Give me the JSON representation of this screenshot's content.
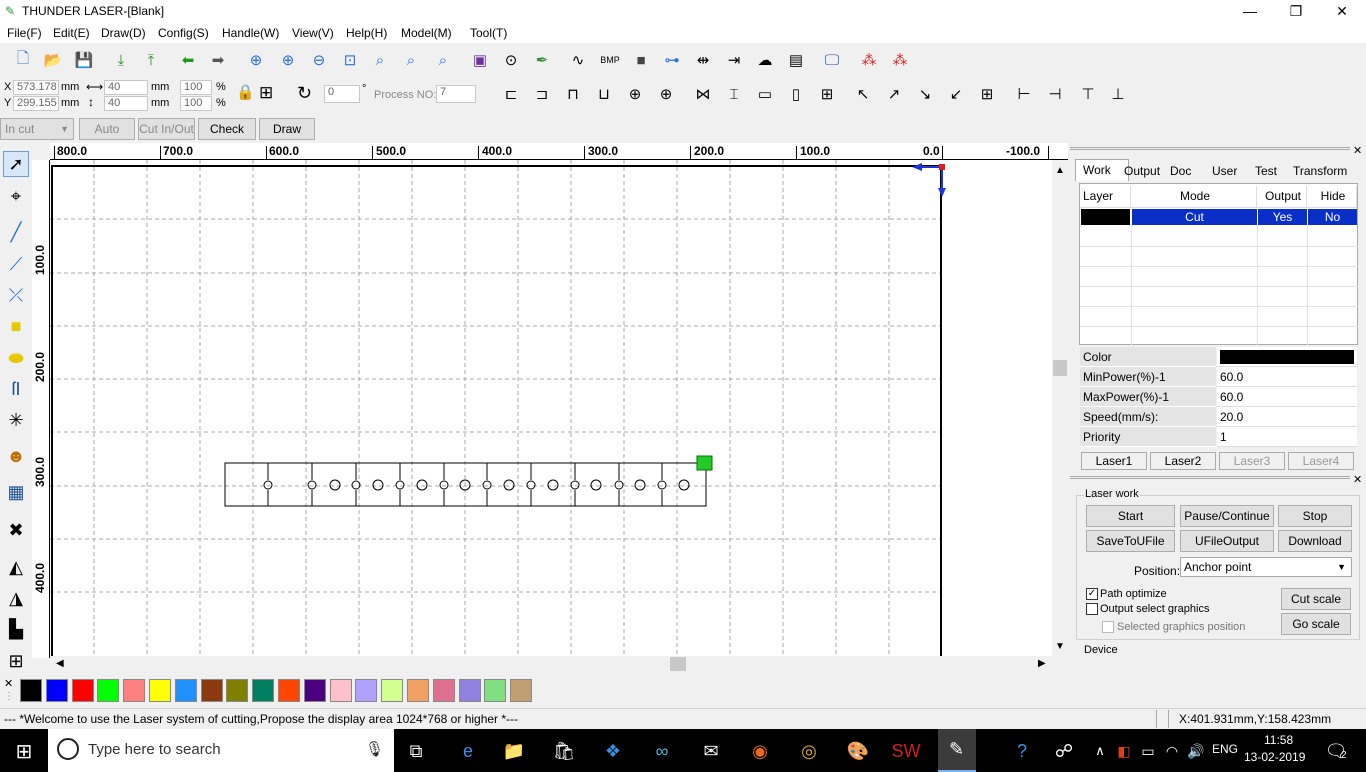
{
  "window": {
    "title": "THUNDER LASER-[Blank]"
  },
  "menu": [
    "File(F)",
    "Edit(E)",
    "Draw(D)",
    "Config(S)",
    "Handle(W)",
    "View(V)",
    "Help(H)",
    "Model(M)",
    "Tool(T)"
  ],
  "coords": {
    "x_label": "X",
    "x_value": "573.178",
    "y_label": "Y",
    "y_value": "299.155",
    "unit": "mm",
    "width_value": "40",
    "height_value": "40",
    "scale_w": "100",
    "scale_h": "100",
    "percent": "%",
    "rotate_value": "0",
    "degree": "°",
    "process_label": "Process NO:",
    "process_value": "7"
  },
  "toolbar3": {
    "mode_select": "In cut",
    "auto": "Auto",
    "cut_inout": "Cut In/Out",
    "check": "Check",
    "draw": "Draw"
  },
  "ruler_top": [
    "800.0",
    "700.0",
    "600.0",
    "500.0",
    "400.0",
    "300.0",
    "200.0",
    "100.0",
    "0.0",
    "-100.0"
  ],
  "ruler_left": [
    "100.0",
    "200.0",
    "300.0",
    "400.0"
  ],
  "panel": {
    "tabs": [
      "Work",
      "Output",
      "Doc",
      "User",
      "Test",
      "Transform"
    ],
    "layer_headers": [
      "Layer",
      "Mode",
      "Output",
      "Hide"
    ],
    "layer_row": {
      "mode": "Cut",
      "output": "Yes",
      "hide": "No",
      "color": "#000000"
    },
    "props": [
      {
        "label": "Color",
        "value": ""
      },
      {
        "label": "MinPower(%)-1",
        "value": "60.0"
      },
      {
        "label": "MaxPower(%)-1",
        "value": "60.0"
      },
      {
        "label": "Speed(mm/s):",
        "value": "20.0"
      },
      {
        "label": "Priority",
        "value": "1"
      }
    ],
    "laser_tabs": [
      "Laser1",
      "Laser2",
      "Laser3",
      "Laser4"
    ],
    "laser_work_title": "Laser work",
    "buttons": [
      "Start",
      "Pause/Continue",
      "Stop",
      "SaveToUFile",
      "UFileOutput",
      "Download"
    ],
    "position_label": "Position:",
    "position_value": "Anchor point",
    "path_optimize": "Path optimize",
    "output_select": "Output select graphics",
    "selected_pos": "Selected graphics position",
    "cut_scale": "Cut scale",
    "go_scale": "Go scale",
    "device_title": "Device"
  },
  "palette": [
    "#000000",
    "#0000ff",
    "#ff0000",
    "#00ff00",
    "#ff8080",
    "#ffff00",
    "#1e90ff",
    "#8b3a0f",
    "#808000",
    "#008060",
    "#ff4500",
    "#4b0082",
    "#ffc0cb",
    "#b0a0ff",
    "#d0ff90",
    "#f0a060",
    "#e07090",
    "#9080e0",
    "#80e080",
    "#c0a070"
  ],
  "status": {
    "message": "--- *Welcome to use the Laser system of cutting,Propose the display area 1024*768 or higher *---",
    "coords": "X:401.931mm,Y:158.423mm"
  },
  "taskbar": {
    "search_placeholder": "Type here to search",
    "lang": "ENG",
    "time": "11:58",
    "date": "13-02-2019",
    "notif_count": "2"
  }
}
